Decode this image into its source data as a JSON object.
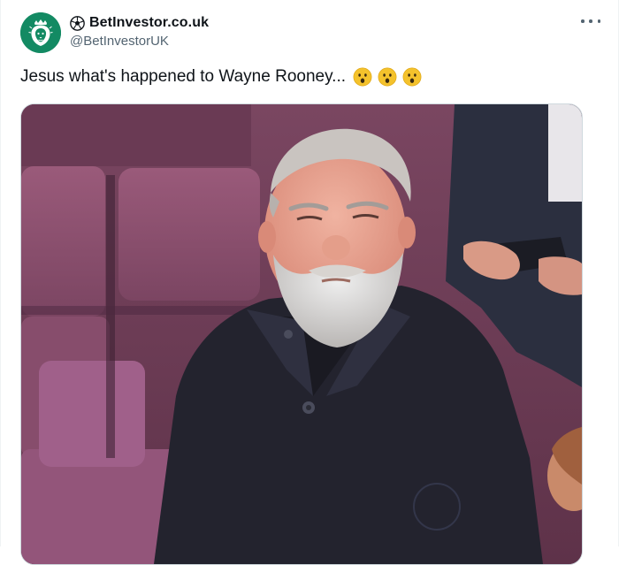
{
  "author": {
    "display_name": "BetInvestor.co.uk",
    "handle": "@BetInvestorUK",
    "avatar_icon": "lion-crest-icon",
    "name_prefix_icon": "football-icon",
    "avatar_color": "#138a63"
  },
  "tweet": {
    "text": "Jesus what's happened to Wayne Rooney...",
    "emoji_icon": "hushed-face-emoji",
    "emoji_count": 3
  },
  "media": {
    "type": "photo"
  },
  "colors": {
    "text_primary": "#0f1419",
    "text_secondary": "#536471",
    "border": "#cfd9de"
  }
}
